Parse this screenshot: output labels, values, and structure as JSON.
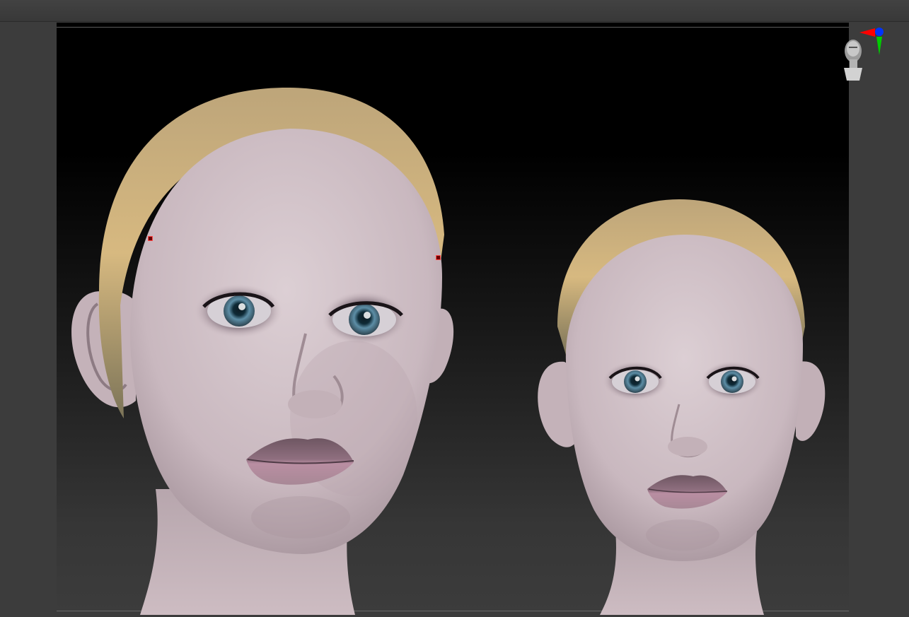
{
  "viewport": {
    "background_top": "#000000",
    "background_bottom": "#3c3c3c"
  },
  "models": [
    {
      "name": "large-head",
      "skin": "#d6c6cc",
      "cap": "#c9ad72",
      "eyes": "#5d8ea6",
      "lips": "#b2899b"
    },
    {
      "name": "small-head",
      "skin": "#d6c6cc",
      "cap": "#c9ad72",
      "eyes": "#5d8ea6",
      "lips": "#b2899b"
    }
  ],
  "navigation_widget": {
    "icon": "head-orientation-icon",
    "axis_colors": {
      "x": "#ff0000",
      "y": "#00cc00",
      "z": "#0033ff"
    }
  }
}
